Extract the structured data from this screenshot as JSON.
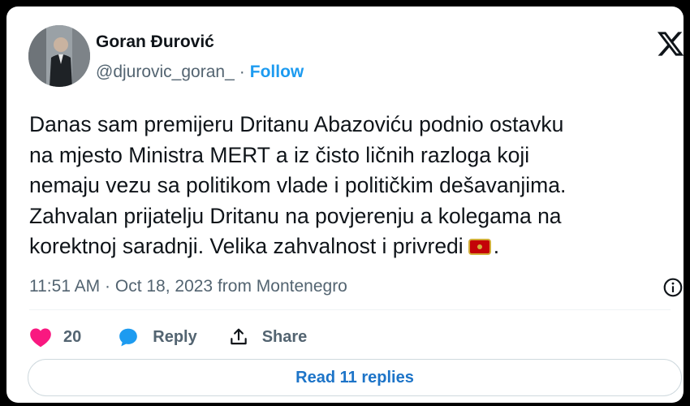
{
  "author": {
    "name": "Goran Đurović",
    "handle": "@djurovic_goran_",
    "separator": "·",
    "follow_label": "Follow",
    "avatar_icon": "profile-photo"
  },
  "platform_icon": "x-logo-icon",
  "tweet": {
    "lines": [
      "Danas sam premijeru Dritanu Abazoviću podnio ostavku",
      "na mjesto Ministra MERT a iz čisto ličnih razloga koji",
      "nemaju vezu sa politikom vlade i političkim dešavanjima.",
      "Zahvalan prijatelju Dritanu na povjerenju a kolegama na",
      "korektnoj saradnji. Velika zahvalnost i privredi"
    ],
    "trailing_emoji": "flag-montenegro",
    "trailing_text": "."
  },
  "meta": {
    "time": "11:51 AM",
    "separator": "·",
    "date": "Oct 18, 2023",
    "location": "from Montenegro"
  },
  "actions": {
    "like_count": "20",
    "reply_label": "Reply",
    "share_label": "Share"
  },
  "read_replies_label": "Read 11 replies",
  "colors": {
    "accent": "#1d9bf0",
    "like": "#f91880",
    "reply_icon": "#1d9bf0",
    "secondary_text": "#536471"
  }
}
